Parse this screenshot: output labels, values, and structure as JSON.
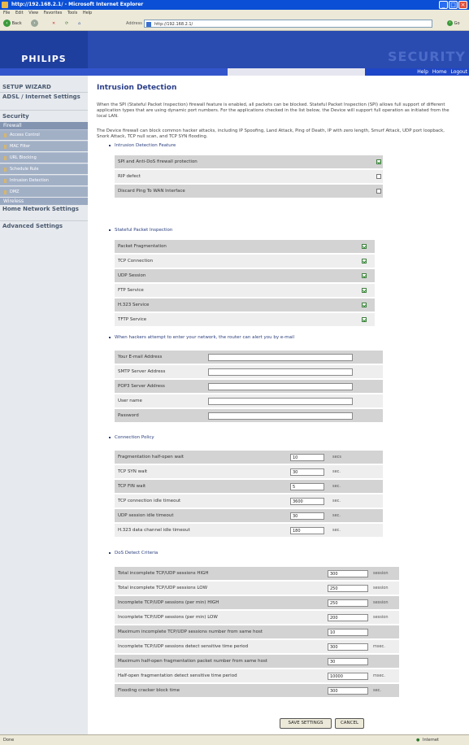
{
  "window": {
    "title": "http://192.168.2.1/ - Microsoft Internet Explorer"
  },
  "menu": [
    "File",
    "Edit",
    "View",
    "Favorites",
    "Tools",
    "Help"
  ],
  "toolbar": {
    "back_label": "Back",
    "address_label": "Address",
    "address_value": "http://192.168.2.1/",
    "go_label": "Go"
  },
  "header": {
    "logo": "PHILIPS",
    "product": "SECURITY",
    "links": [
      "Help",
      "Home",
      "Logout"
    ]
  },
  "sidebar": {
    "setup_wizard": "SETUP WIZARD",
    "adsl": "ADSL / Internet Settings",
    "security": "Security",
    "firewall": "Firewall",
    "subitems": [
      "Access Control",
      "MAC Filter",
      "URL Blocking",
      "Schedule Rule",
      "Intrusion Detection",
      "DMZ"
    ],
    "wireless": "Wireless",
    "home_network": "Home Network Settings",
    "advanced": "Advanced Settings"
  },
  "page": {
    "title": "Intrusion Detection",
    "para1": "When the SPI (Stateful Packet Inspection) firewall feature is enabled, all packets can be blocked.  Stateful Packet Inspection (SPI) allows full support of different application types that are using dynamic port numbers.  For the applications checked in the list below, the Device will support full operation as initiated from the local LAN.",
    "para2": "The Device firewall can block common hacker attacks, including IP Spoofing, Land Attack, Ping of Death, IP with zero length, Smurf Attack, UDP port loopback, Snork Attack, TCP null scan, and TCP SYN flooding."
  },
  "intrusion": {
    "heading": "Intrusion Detection Feature",
    "rows": [
      {
        "label": "SPI and Anti-DoS firewall protection",
        "checked": true
      },
      {
        "label": "RIP defect",
        "checked": false
      },
      {
        "label": "Discard Ping To WAN Interface",
        "checked": false
      }
    ]
  },
  "spi": {
    "heading": "Stateful Packet Inspection",
    "rows": [
      {
        "label": "Packet Fragmentation",
        "checked": true
      },
      {
        "label": "TCP Connection",
        "checked": true
      },
      {
        "label": "UDP Session",
        "checked": true
      },
      {
        "label": "FTP Service",
        "checked": true
      },
      {
        "label": "H.323 Service",
        "checked": true
      },
      {
        "label": "TFTP  Service",
        "checked": true
      }
    ]
  },
  "email": {
    "heading": "When hackers attempt to enter your network, the router can alert you by e-mail",
    "rows": [
      {
        "label": "Your E-mail Address",
        "value": ""
      },
      {
        "label": "SMTP Server Address",
        "value": ""
      },
      {
        "label": "POP3 Server Address",
        "value": ""
      },
      {
        "label": "User name",
        "value": ""
      },
      {
        "label": "Password",
        "value": ""
      }
    ]
  },
  "policy": {
    "heading": "Connection Policy",
    "rows": [
      {
        "label": "Fragmentation half-open wait",
        "value": "10",
        "unit": "secs"
      },
      {
        "label": "TCP SYN wait",
        "value": "30",
        "unit": "sec."
      },
      {
        "label": "TCP FIN wait",
        "value": "5",
        "unit": "sec."
      },
      {
        "label": "TCP connection idle timeout",
        "value": "3600",
        "unit": "sec."
      },
      {
        "label": "UDP session idle timeout",
        "value": "30",
        "unit": "sec."
      },
      {
        "label": "H.323 data channel idle timeout",
        "value": "180",
        "unit": "sec."
      }
    ]
  },
  "dos": {
    "heading": "DoS Detect Criteria",
    "rows": [
      {
        "label": "Total incomplete TCP/UDP sessions HIGH",
        "value": "300",
        "unit": "session"
      },
      {
        "label": "Total incomplete TCP/UDP sessions LOW",
        "value": "250",
        "unit": "session"
      },
      {
        "label": "Incomplete TCP/UDP sessions (per min) HIGH",
        "value": "250",
        "unit": "session"
      },
      {
        "label": "Incomplete TCP/UDP sessions (per min) LOW",
        "value": "200",
        "unit": "session"
      },
      {
        "label": "Maximum incomplete TCP/UDP sessions number from same host",
        "value": "10",
        "unit": ""
      },
      {
        "label": "Incomplete TCP/UDP sessions detect sensitive time period",
        "value": "300",
        "unit": "msec."
      },
      {
        "label": "Maximum half-open fragmentation packet number from same host",
        "value": "30",
        "unit": ""
      },
      {
        "label": "Half-open fragmentation detect sensitive time period",
        "value": "10000",
        "unit": "msec."
      },
      {
        "label": "Flooding cracker block time",
        "value": "300",
        "unit": "sec."
      }
    ]
  },
  "actions": {
    "save": "SAVE SETTINGS",
    "cancel": "CANCEL"
  },
  "status": {
    "left": "Done",
    "right": "Internet"
  },
  "colors": {
    "header": "#2a4bb0",
    "sidebar": "#e6e9ed",
    "row_dark": "#d3d3d3",
    "row_light": "#eeeeee"
  }
}
